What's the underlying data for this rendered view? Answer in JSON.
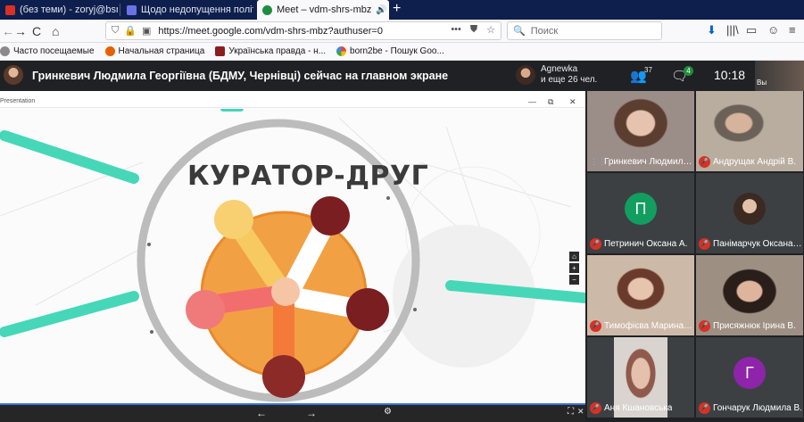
{
  "browser": {
    "tabs": [
      {
        "label": "(без теми) - zoryj@bsmu.edu.",
        "favicon_color": "#d93025"
      },
      {
        "label": "Щодо недопущення політичн",
        "favicon_color": "#6b72e8"
      },
      {
        "label": "Meet – vdm-shrs-mbz",
        "favicon_color": "#1e8e3e",
        "active": true
      }
    ],
    "new_tab": "+",
    "close_glyph": "✕",
    "audio_glyph": "🔊"
  },
  "navbar": {
    "back": "←",
    "forward": "→",
    "reload": "C",
    "home": "⌂",
    "url": "https://meet.google.com/vdm-shrs-mbz?authuser=0",
    "more": "•••",
    "bookmark_star": "☆",
    "search_placeholder": "Поиск",
    "download": "⬇",
    "library": "|||\\",
    "sidebar": "▭",
    "account": "☺",
    "menu": "≡"
  },
  "bookmarks": [
    {
      "label": "Часто посещаемые",
      "color": "#6d6d6d"
    },
    {
      "label": "Начальная страница",
      "color": "#e66000"
    },
    {
      "label": "Українська правда - н...",
      "color": "#8b1d1d"
    },
    {
      "label": "born2be - Пошук Goo...",
      "color": "#4285f4"
    }
  ],
  "meet": {
    "presenter_banner": "Гринкевич Людмила Георгіївна (БДМУ, Чернівці) сейчас на главном экране",
    "viewer_name": "Agnewka",
    "viewer_more": "и еще 26 чел.",
    "participants_count": "37",
    "chat_count": "4",
    "time": "10:18",
    "self_label": "Вы"
  },
  "presentation": {
    "window_label": "Presentation",
    "minimize": "—",
    "restore": "⧉",
    "close": "✕",
    "slide_title": "КУРАТОР-ДРУГ",
    "side_controls": [
      "⌂",
      "+",
      "−"
    ],
    "prev": "←",
    "next": "→",
    "settings": "⚙",
    "fullscreen": "⛶",
    "exit": "✕"
  },
  "participants": [
    {
      "name": "Гринкевич Людмила Георгіївна",
      "muted": false,
      "video": true,
      "bg": "#a38f86"
    },
    {
      "name": "Андрущак Андрій В.",
      "muted": true,
      "video": true,
      "bg": "#b9ad9f"
    },
    {
      "name": "Петринич Оксана А.",
      "muted": true,
      "letter": "П",
      "avatar_color": "#129e5f"
    },
    {
      "name": "Панімарчук Оксана В.",
      "muted": true,
      "photo": true
    },
    {
      "name": "Тимофієва Марина В.",
      "muted": true,
      "video": true,
      "bg": "#cbb7a6"
    },
    {
      "name": "Присяжнюк Ірина В.",
      "muted": true,
      "video": true,
      "bg": "#9e8f83"
    },
    {
      "name": "Аня Кшановська",
      "muted": true,
      "video": true,
      "bg": "#c9c4c0"
    },
    {
      "name": "Гончарук Людмила В.",
      "muted": true,
      "letter": "Г",
      "avatar_color": "#8e24aa"
    }
  ]
}
